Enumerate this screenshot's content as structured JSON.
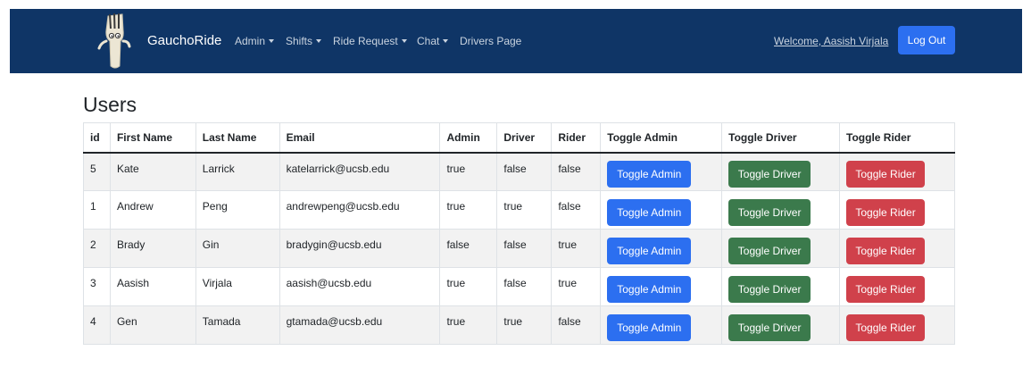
{
  "navbar": {
    "brand": "GauchoRide",
    "menu": [
      {
        "label": "Admin",
        "dropdown": true
      },
      {
        "label": "Shifts",
        "dropdown": true
      },
      {
        "label": "Ride Request",
        "dropdown": true
      },
      {
        "label": "Chat",
        "dropdown": true
      },
      {
        "label": "Drivers Page",
        "dropdown": false
      }
    ],
    "welcome": "Welcome, Aasish Virjala",
    "logout_label": "Log Out",
    "logo_icon": "gaucho-fork-mascot-icon"
  },
  "page": {
    "title": "Users"
  },
  "table": {
    "headers": [
      "id",
      "First Name",
      "Last Name",
      "Email",
      "Admin",
      "Driver",
      "Rider",
      "Toggle Admin",
      "Toggle Driver",
      "Toggle Rider"
    ],
    "rows": [
      {
        "id": "5",
        "first": "Kate",
        "last": "Larrick",
        "email": "katelarrick@ucsb.edu",
        "admin": "true",
        "driver": "false",
        "rider": "false"
      },
      {
        "id": "1",
        "first": "Andrew",
        "last": "Peng",
        "email": "andrewpeng@ucsb.edu",
        "admin": "true",
        "driver": "true",
        "rider": "false"
      },
      {
        "id": "2",
        "first": "Brady",
        "last": "Gin",
        "email": "bradygin@ucsb.edu",
        "admin": "false",
        "driver": "false",
        "rider": "true"
      },
      {
        "id": "3",
        "first": "Aasish",
        "last": "Virjala",
        "email": "aasish@ucsb.edu",
        "admin": "true",
        "driver": "false",
        "rider": "true"
      },
      {
        "id": "4",
        "first": "Gen",
        "last": "Tamada",
        "email": "gtamada@ucsb.edu",
        "admin": "true",
        "driver": "true",
        "rider": "false"
      }
    ],
    "buttons": {
      "toggle_admin": "Toggle Admin",
      "toggle_driver": "Toggle Driver",
      "toggle_rider": "Toggle Rider"
    }
  },
  "colors": {
    "navbar_bg": "#0f3566",
    "primary": "#2c6ff0",
    "success": "#3b7a4c",
    "danger": "#d0414b"
  }
}
